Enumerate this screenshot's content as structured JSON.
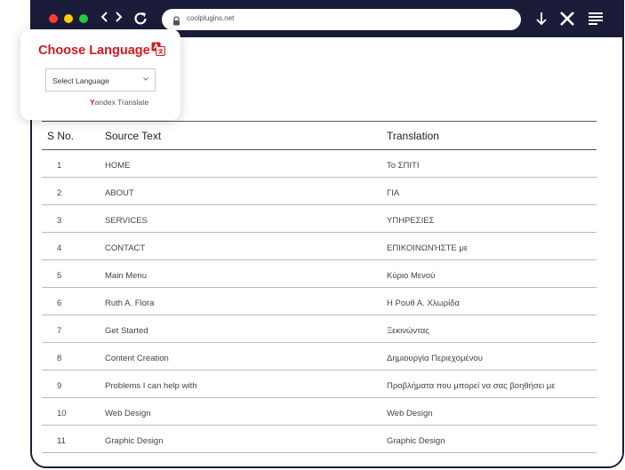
{
  "browser": {
    "url": "coolplugins.net",
    "colors": {
      "frame": "#1b1b3a",
      "close": "#ff3b30",
      "minimize": "#ffcc00",
      "maximize": "#28c840"
    },
    "icons": [
      "back-icon",
      "forward-icon",
      "reload-icon",
      "lock-icon",
      "download-icon",
      "close-x-icon",
      "menu-icon"
    ]
  },
  "language_widget": {
    "title": "Choose Language",
    "select_value": "Select Language",
    "powered_by_y": "Y",
    "powered_by_rest": "andex",
    "powered_by_suffix": "Translate",
    "accent": "#d2191f"
  },
  "table": {
    "headers": {
      "sno": "S No.",
      "source": "Source Text",
      "translation": "Translation"
    },
    "rows": [
      {
        "sno": "1",
        "source": "HOME",
        "translation": "Το ΣΠΙΤΙ"
      },
      {
        "sno": "2",
        "source": "ABOUT",
        "translation": "ΓΙΑ"
      },
      {
        "sno": "3",
        "source": "SERVICES",
        "translation": "ΥΠΗΡΕΣΙΕΣ"
      },
      {
        "sno": "4",
        "source": "CONTACT",
        "translation": "ΕΠΙΚΟΙΝΩΝΉΣΤΕ με"
      },
      {
        "sno": "5",
        "source": "Main Menu",
        "translation": "Κύριο Μενού"
      },
      {
        "sno": "6",
        "source": "Ruth A. Flora",
        "translation": "Η Ρουθ Α. Χλωρίδα"
      },
      {
        "sno": "7",
        "source": "Get Started",
        "translation": "Ξεκινώντας"
      },
      {
        "sno": "8",
        "source": "Content Creation",
        "translation": "Δημιουργία Περιεχομένου"
      },
      {
        "sno": "9",
        "source": "Problems I can help with",
        "translation": "Προβλήματα που μπορεί να σας βοηθήσει με"
      },
      {
        "sno": "10",
        "source": "Web Design",
        "translation": "Web Design"
      },
      {
        "sno": "11",
        "source": "Graphic Design",
        "translation": "Graphic Design"
      }
    ]
  }
}
